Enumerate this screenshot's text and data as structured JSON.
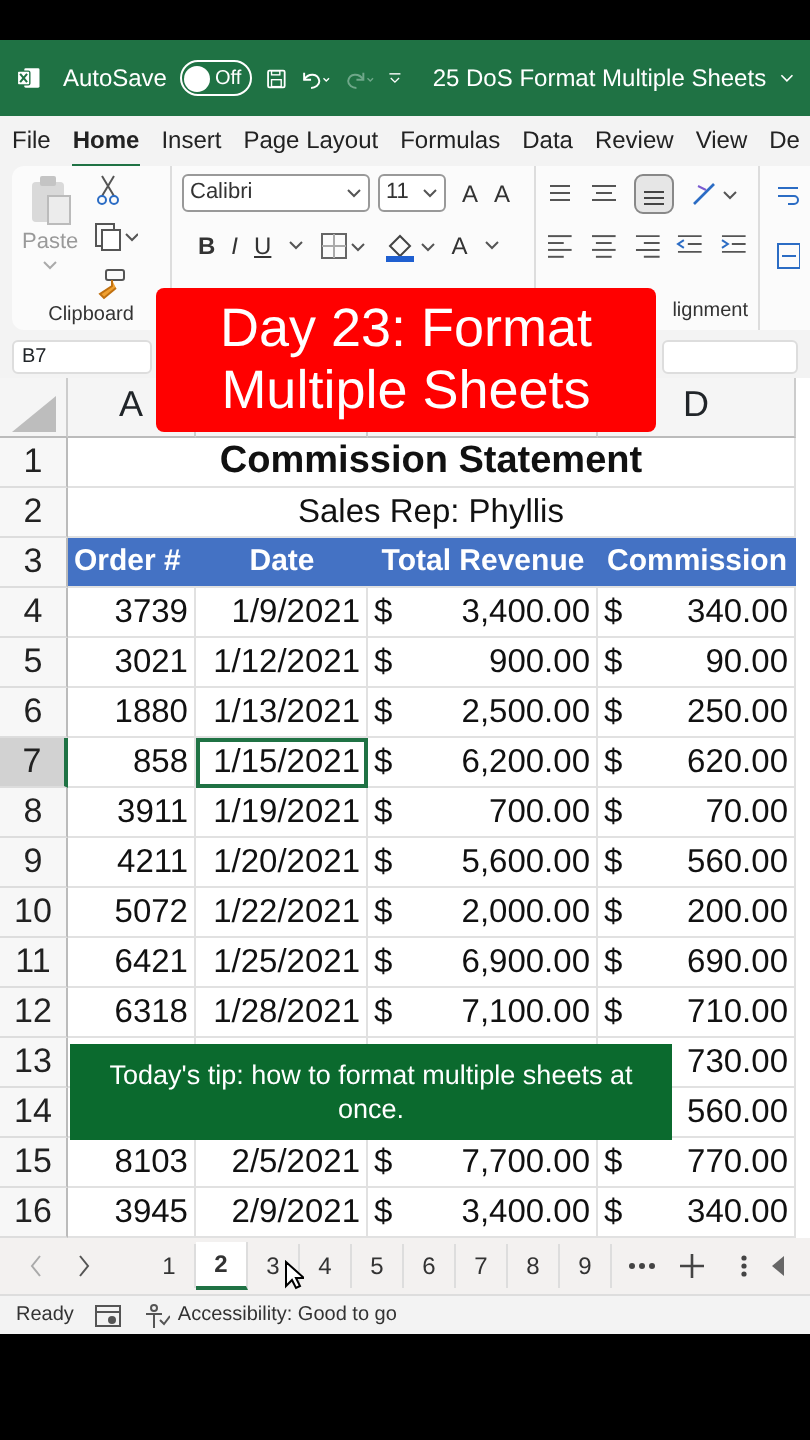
{
  "title_bar": {
    "autosave_label": "AutoSave",
    "autosave_on": false,
    "toggle_text": "Off",
    "file_name": "25 DoS Format Multiple Sheets"
  },
  "menu_tabs": [
    {
      "label": "File",
      "selected": false
    },
    {
      "label": "Home",
      "selected": true
    },
    {
      "label": "Insert",
      "selected": false
    },
    {
      "label": "Page Layout",
      "selected": false
    },
    {
      "label": "Formulas",
      "selected": false
    },
    {
      "label": "Data",
      "selected": false
    },
    {
      "label": "Review",
      "selected": false
    },
    {
      "label": "View",
      "selected": false
    },
    {
      "label": "De",
      "selected": false
    }
  ],
  "ribbon": {
    "paste_label": "Paste",
    "clipboard_label": "Clipboard",
    "font_name": "Calibri",
    "font_size": "11",
    "grow_font": "A",
    "shrink_font": "A",
    "bold": "B",
    "italic": "I",
    "underline": "U",
    "font_color": "A",
    "alignment_label": "lignment"
  },
  "name_box": "B7",
  "column_headers": [
    "A",
    "D"
  ],
  "top_row_numbers": [
    "1",
    "2",
    "3"
  ],
  "sheet_title": "Commission Statement",
  "sheet_subtitle": "Sales Rep: Phyllis",
  "table_header": [
    "Order #",
    "Date",
    "Total Revenue",
    "Commission"
  ],
  "rows": [
    {
      "num": "4",
      "order": "3739",
      "date": "1/9/2021",
      "revenue_currency": "$",
      "revenue": "3,400.00",
      "commission_currency": "$",
      "commission": "340.00",
      "selected": false
    },
    {
      "num": "5",
      "order": "3021",
      "date": "1/12/2021",
      "revenue_currency": "$",
      "revenue": "900.00",
      "commission_currency": "$",
      "commission": "90.00",
      "selected": false
    },
    {
      "num": "6",
      "order": "1880",
      "date": "1/13/2021",
      "revenue_currency": "$",
      "revenue": "2,500.00",
      "commission_currency": "$",
      "commission": "250.00",
      "selected": false
    },
    {
      "num": "7",
      "order": "858",
      "date": "1/15/2021",
      "revenue_currency": "$",
      "revenue": "6,200.00",
      "commission_currency": "$",
      "commission": "620.00",
      "selected": true
    },
    {
      "num": "8",
      "order": "3911",
      "date": "1/19/2021",
      "revenue_currency": "$",
      "revenue": "700.00",
      "commission_currency": "$",
      "commission": "70.00",
      "selected": false
    },
    {
      "num": "9",
      "order": "4211",
      "date": "1/20/2021",
      "revenue_currency": "$",
      "revenue": "5,600.00",
      "commission_currency": "$",
      "commission": "560.00",
      "selected": false
    },
    {
      "num": "10",
      "order": "5072",
      "date": "1/22/2021",
      "revenue_currency": "$",
      "revenue": "2,000.00",
      "commission_currency": "$",
      "commission": "200.00",
      "selected": false
    },
    {
      "num": "11",
      "order": "6421",
      "date": "1/25/2021",
      "revenue_currency": "$",
      "revenue": "6,900.00",
      "commission_currency": "$",
      "commission": "690.00",
      "selected": false
    },
    {
      "num": "12",
      "order": "6318",
      "date": "1/28/2021",
      "revenue_currency": "$",
      "revenue": "7,100.00",
      "commission_currency": "$",
      "commission": "710.00",
      "selected": false
    },
    {
      "num": "13",
      "commission": "730.00",
      "selected": false
    },
    {
      "num": "14",
      "commission": "560.00",
      "selected": false
    },
    {
      "num": "15",
      "order": "8103",
      "date": "2/5/2021",
      "revenue_currency": "$",
      "revenue": "7,700.00",
      "commission_currency": "$",
      "commission": "770.00",
      "selected": false
    },
    {
      "num": "16",
      "order": "3945",
      "date": "2/9/2021",
      "revenue_currency": "$",
      "revenue": "3,400.00",
      "commission_currency": "$",
      "commission": "340.00",
      "selected": false
    }
  ],
  "sheet_tabs": [
    {
      "label": "1",
      "selected": false
    },
    {
      "label": "2",
      "selected": true
    },
    {
      "label": "3",
      "selected": false
    },
    {
      "label": "4",
      "selected": false
    },
    {
      "label": "5",
      "selected": false
    },
    {
      "label": "6",
      "selected": false
    },
    {
      "label": "7",
      "selected": false
    },
    {
      "label": "8",
      "selected": false
    },
    {
      "label": "9",
      "selected": false
    }
  ],
  "status_bar": {
    "state": "Ready",
    "accessibility": "Accessibility: Good to go"
  },
  "banner": {
    "text": "Day 23: Format Multiple Sheets"
  },
  "tip": {
    "text": "Today's tip: how to format multiple sheets at once."
  }
}
